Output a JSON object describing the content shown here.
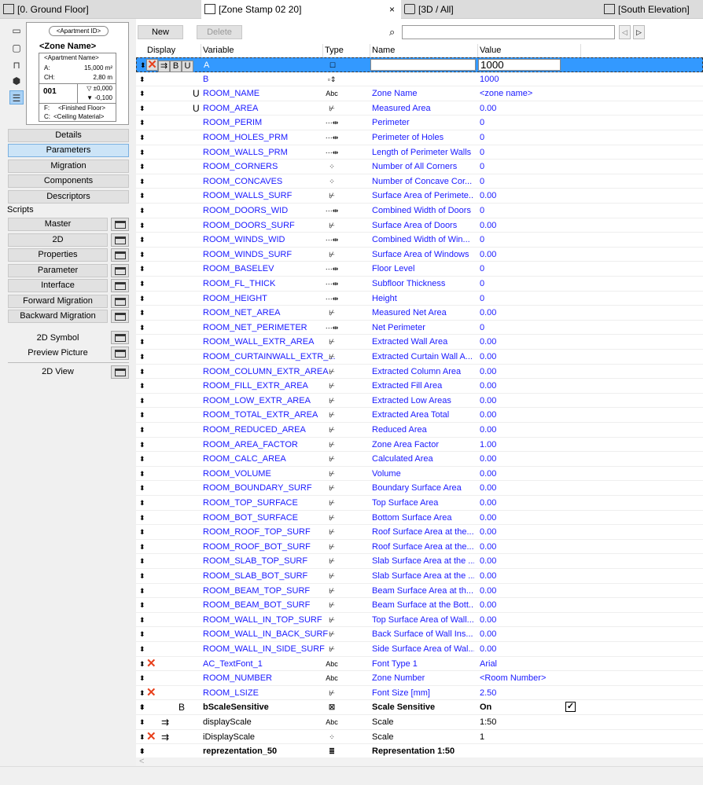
{
  "tabs": [
    {
      "label": "[0. Ground Floor]"
    },
    {
      "label": "[Zone Stamp 02 20]",
      "close": "×"
    },
    {
      "label": "[3D / All]"
    },
    {
      "label": "[South Elevation]"
    }
  ],
  "preview": {
    "apartment_id": "<Apartment ID>",
    "zone_name": "<Zone Name>",
    "apartment_name": "<Apartment Name>",
    "a_label": "A:",
    "a_value": "15,000 m²",
    "ch_label": "CH:",
    "ch_value": "2,80 m",
    "number": "001",
    "level_top": "▽ ±0,000",
    "level_bottom": "▼ -0,100",
    "f_label": "F:",
    "f_value": "<Finished Floor>",
    "c_label": "C:",
    "c_value": "<Ceiling Material>"
  },
  "left_buttons": [
    "Details",
    "Parameters",
    "Migration",
    "Components",
    "Descriptors"
  ],
  "scripts_label": "Scripts",
  "script_buttons": [
    "Master",
    "2D",
    "Properties",
    "Parameter",
    "Interface",
    "Forward Migration",
    "Backward Migration"
  ],
  "extra": {
    "symbol_2d": "2D Symbol",
    "preview_picture": "Preview Picture",
    "view_2d": "2D View"
  },
  "toolbar": {
    "new": "New",
    "delete": "Delete",
    "search_value": ""
  },
  "headers": {
    "display": "Display",
    "variable": "Variable",
    "type": "Type",
    "name": "Name",
    "value": "Value"
  },
  "rows": [
    {
      "var": "A",
      "type": "length-h",
      "name": "",
      "value": "1000",
      "sel": true,
      "flags": [
        "x",
        "arrow",
        "B",
        "U"
      ]
    },
    {
      "var": "B",
      "type": "length-v",
      "name": "",
      "value": "1000"
    },
    {
      "var": "ROOM_NAME",
      "type": "text",
      "name": "Zone Name",
      "value": "<zone name>",
      "u": "U"
    },
    {
      "var": "ROOM_AREA",
      "type": "area",
      "name": "Measured Area",
      "value": "0.00",
      "u": "U"
    },
    {
      "var": "ROOM_PERIM",
      "type": "length",
      "name": "Perimeter",
      "value": "0"
    },
    {
      "var": "ROOM_HOLES_PRM",
      "type": "length",
      "name": "Perimeter of Holes",
      "value": "0"
    },
    {
      "var": "ROOM_WALLS_PRM",
      "type": "length",
      "name": "Length of Perimeter Walls",
      "value": "0"
    },
    {
      "var": "ROOM_CORNERS",
      "type": "integer",
      "name": "Number of All Corners",
      "value": "0"
    },
    {
      "var": "ROOM_CONCAVES",
      "type": "integer",
      "name": "Number of Concave Cor...",
      "value": "0"
    },
    {
      "var": "ROOM_WALLS_SURF",
      "type": "area",
      "name": "Surface Area of Perimete...",
      "value": "0.00"
    },
    {
      "var": "ROOM_DOORS_WID",
      "type": "length",
      "name": "Combined Width of Doors",
      "value": "0"
    },
    {
      "var": "ROOM_DOORS_SURF",
      "type": "area",
      "name": "Surface Area of Doors",
      "value": "0.00"
    },
    {
      "var": "ROOM_WINDS_WID",
      "type": "length",
      "name": "Combined Width of Win...",
      "value": "0"
    },
    {
      "var": "ROOM_WINDS_SURF",
      "type": "area",
      "name": "Surface Area of Windows",
      "value": "0.00"
    },
    {
      "var": "ROOM_BASELEV",
      "type": "length",
      "name": "Floor Level",
      "value": "0"
    },
    {
      "var": "ROOM_FL_THICK",
      "type": "length",
      "name": "Subfloor Thickness",
      "value": "0"
    },
    {
      "var": "ROOM_HEIGHT",
      "type": "length",
      "name": "Height",
      "value": "0"
    },
    {
      "var": "ROOM_NET_AREA",
      "type": "area",
      "name": "Measured Net Area",
      "value": "0.00"
    },
    {
      "var": "ROOM_NET_PERIMETER",
      "type": "length",
      "name": "Net Perimeter",
      "value": "0"
    },
    {
      "var": "ROOM_WALL_EXTR_AREA",
      "type": "area",
      "name": "Extracted Wall Area",
      "value": "0.00"
    },
    {
      "var": "ROOM_CURTAINWALL_EXTR_...",
      "type": "area",
      "name": "Extracted Curtain Wall A...",
      "value": "0.00"
    },
    {
      "var": "ROOM_COLUMN_EXTR_AREA",
      "type": "area",
      "name": "Extracted Column Area",
      "value": "0.00"
    },
    {
      "var": "ROOM_FILL_EXTR_AREA",
      "type": "area",
      "name": "Extracted Fill Area",
      "value": "0.00"
    },
    {
      "var": "ROOM_LOW_EXTR_AREA",
      "type": "area",
      "name": "Extracted Low Areas",
      "value": "0.00"
    },
    {
      "var": "ROOM_TOTAL_EXTR_AREA",
      "type": "area",
      "name": "Extracted Area Total",
      "value": "0.00"
    },
    {
      "var": "ROOM_REDUCED_AREA",
      "type": "area",
      "name": "Reduced Area",
      "value": "0.00"
    },
    {
      "var": "ROOM_AREA_FACTOR",
      "type": "area",
      "name": "Zone Area Factor",
      "value": "1.00"
    },
    {
      "var": "ROOM_CALC_AREA",
      "type": "area",
      "name": "Calculated Area",
      "value": "0.00"
    },
    {
      "var": "ROOM_VOLUME",
      "type": "area",
      "name": "Volume",
      "value": "0.00"
    },
    {
      "var": "ROOM_BOUNDARY_SURF",
      "type": "area",
      "name": "Boundary Surface Area",
      "value": "0.00"
    },
    {
      "var": "ROOM_TOP_SURFACE",
      "type": "area",
      "name": "Top Surface Area",
      "value": "0.00"
    },
    {
      "var": "ROOM_BOT_SURFACE",
      "type": "area",
      "name": "Bottom Surface Area",
      "value": "0.00"
    },
    {
      "var": "ROOM_ROOF_TOP_SURF",
      "type": "area",
      "name": "Roof Surface Area at the...",
      "value": "0.00"
    },
    {
      "var": "ROOM_ROOF_BOT_SURF",
      "type": "area",
      "name": "Roof Surface Area at the...",
      "value": "0.00"
    },
    {
      "var": "ROOM_SLAB_TOP_SURF",
      "type": "area",
      "name": "Slab Surface Area at the ...",
      "value": "0.00"
    },
    {
      "var": "ROOM_SLAB_BOT_SURF",
      "type": "area",
      "name": "Slab Surface Area at the ...",
      "value": "0.00"
    },
    {
      "var": "ROOM_BEAM_TOP_SURF",
      "type": "area",
      "name": "Beam Surface Area at th...",
      "value": "0.00"
    },
    {
      "var": "ROOM_BEAM_BOT_SURF",
      "type": "area",
      "name": "Beam Surface at the Bott...",
      "value": "0.00"
    },
    {
      "var": "ROOM_WALL_IN_TOP_SURF",
      "type": "area",
      "name": "Top Surface Area of Wall...",
      "value": "0.00"
    },
    {
      "var": "ROOM_WALL_IN_BACK_SURF",
      "type": "area",
      "name": "Back Surface of Wall Ins...",
      "value": "0.00"
    },
    {
      "var": "ROOM_WALL_IN_SIDE_SURF",
      "type": "area",
      "name": "Side Surface Area of Wal...",
      "value": "0.00"
    },
    {
      "var": "AC_TextFont_1",
      "type": "text",
      "name": "Font Type 1",
      "value": "Arial",
      "flags": [
        "x"
      ]
    },
    {
      "var": "ROOM_NUMBER",
      "type": "text",
      "name": "Zone Number",
      "value": "<Room Number>"
    },
    {
      "var": "ROOM_LSIZE",
      "type": "area",
      "name": "Font Size [mm]",
      "value": "2.50",
      "flags": [
        "x"
      ]
    },
    {
      "var": "bScaleSensitive",
      "type": "boolean",
      "name": "Scale Sensitive",
      "value": "On",
      "u": "B",
      "style": "bold",
      "checked": true
    },
    {
      "var": "displayScale",
      "type": "text",
      "name": "Scale",
      "value": "1:50",
      "flags": [
        "arrow"
      ],
      "style": "blk"
    },
    {
      "var": "iDisplayScale",
      "type": "integer",
      "name": "Scale",
      "value": "1",
      "flags": [
        "x",
        "arrow"
      ],
      "style": "blk"
    },
    {
      "var": "reprezentation_50",
      "type": "title",
      "name": "Representation 1:50",
      "value": "",
      "style": "bold"
    }
  ]
}
